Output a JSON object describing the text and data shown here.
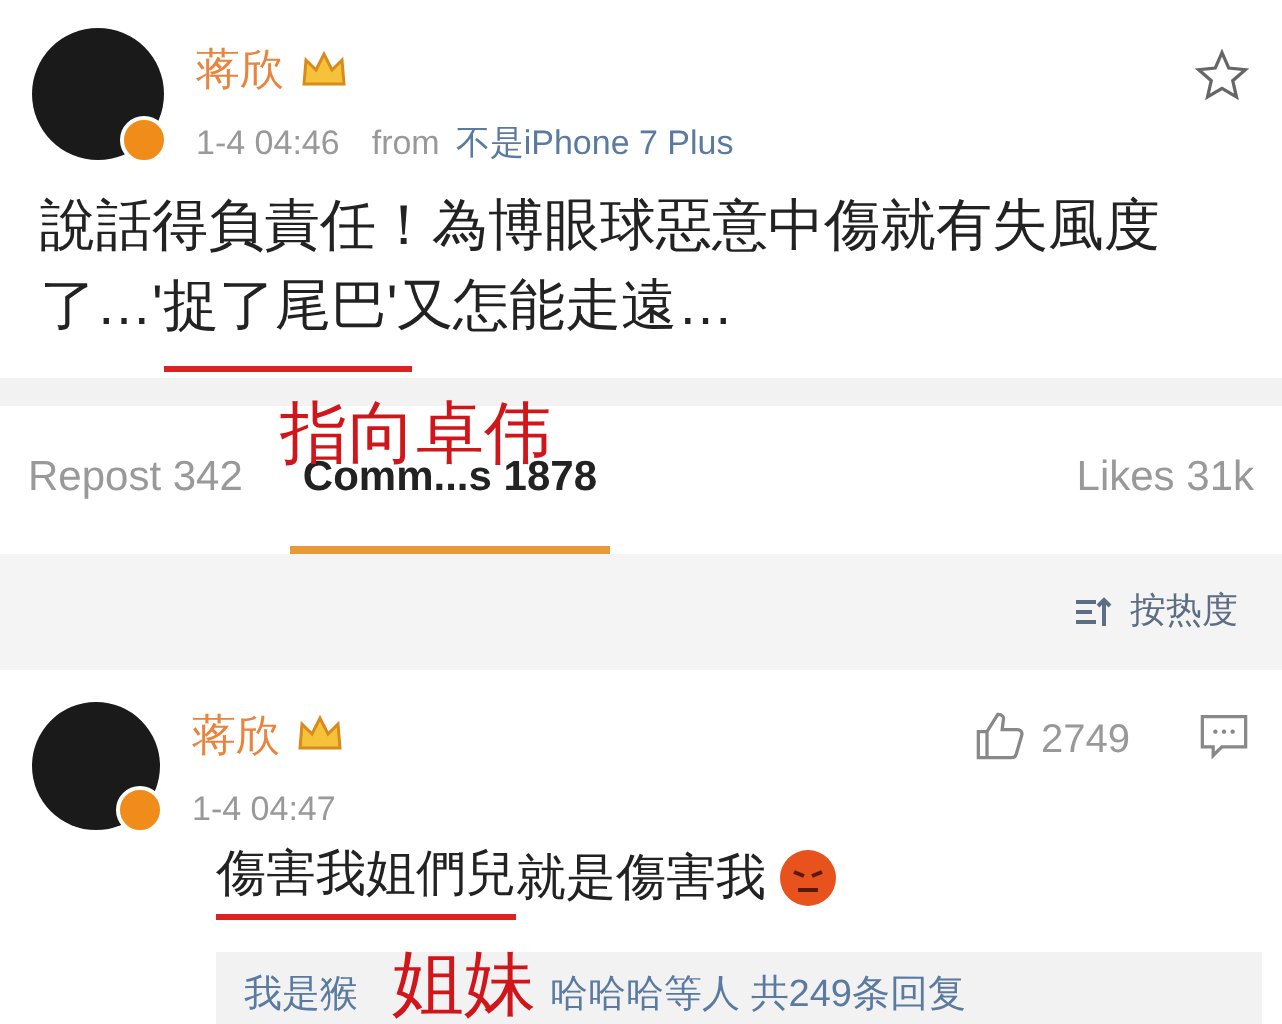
{
  "post": {
    "author": "蒋欣",
    "time": "1-4 04:46",
    "source_prefix": "from",
    "source": "不是iPhone 7 Plus",
    "text": "說話得負責任！為博眼球惡意中傷就有失風度了…'捉了尾巴'又怎能走遠…",
    "starred": false
  },
  "tabs": [
    {
      "label": "Repost 342",
      "selected": false
    },
    {
      "label": "Comm...s 1878",
      "selected": true
    },
    {
      "label": "Likes 31k",
      "selected": false
    }
  ],
  "sort": {
    "label": "按热度"
  },
  "comment": {
    "author": "蒋欣",
    "time": "1-4 04:47",
    "likes": "2749",
    "text_underlined": "傷害我姐們兒",
    "text_rest": "就是傷害我",
    "replies": [
      "我是猴",
      "哈哈哈等人  共249条回复"
    ]
  },
  "annotations": [
    {
      "text": "指向卓伟"
    },
    {
      "text": "姐妹"
    }
  ]
}
